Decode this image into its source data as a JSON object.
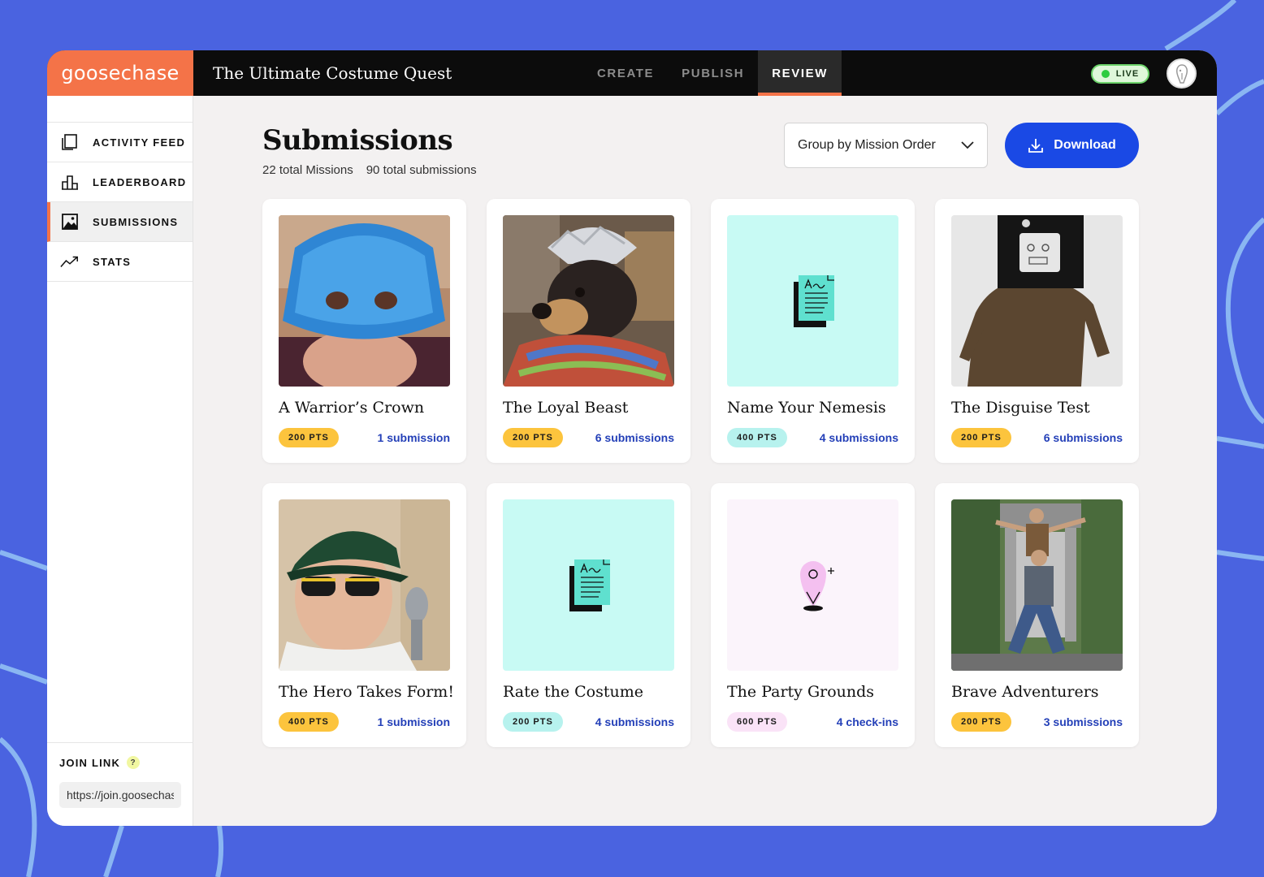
{
  "app": {
    "logo": "goosechase",
    "game_title": "The Ultimate Costume Quest",
    "tabs": [
      {
        "label": "CREATE",
        "active": false
      },
      {
        "label": "PUBLISH",
        "active": false
      },
      {
        "label": "REVIEW",
        "active": true
      }
    ],
    "live_label": "LIVE",
    "accent_color": "#f47348",
    "primary_color": "#1a49e5"
  },
  "sidebar": {
    "items": [
      {
        "label": "ACTIVITY FEED",
        "icon": "activity-feed-icon",
        "active": false
      },
      {
        "label": "LEADERBOARD",
        "icon": "leaderboard-icon",
        "active": false
      },
      {
        "label": "SUBMISSIONS",
        "icon": "image-icon",
        "active": true
      },
      {
        "label": "STATS",
        "icon": "trend-icon",
        "active": false
      }
    ],
    "join_label": "JOIN LINK",
    "join_help": "?",
    "join_url": "https://join.goosechase.ai"
  },
  "main": {
    "title": "Submissions",
    "total_missions": "22 total Missions",
    "total_submissions": "90 total submissions",
    "group_select": "Group by Mission Order",
    "download_label": "Download"
  },
  "missions": [
    {
      "title": "A Warrior’s Crown",
      "points": "200 PTS",
      "count": "1 submission",
      "type": "photo",
      "pts_color": "#fcc43d"
    },
    {
      "title": "The Loyal Beast",
      "points": "200 PTS",
      "count": "6 submissions",
      "type": "photo",
      "pts_color": "#fcc43d"
    },
    {
      "title": "Name Your Nemesis",
      "points": "400 PTS",
      "count": "4 submissions",
      "type": "text",
      "pts_color": "#b7f2ee"
    },
    {
      "title": "The Disguise Test",
      "points": "200 PTS",
      "count": "6 submissions",
      "type": "photo",
      "pts_color": "#fcc43d"
    },
    {
      "title": "The Hero Takes Form!",
      "points": "400 PTS",
      "count": "1 submission",
      "type": "photo",
      "pts_color": "#fcc43d"
    },
    {
      "title": "Rate the Costume",
      "points": "200 PTS",
      "count": "4 submissions",
      "type": "text",
      "pts_color": "#b7f2ee"
    },
    {
      "title": "The Party Grounds",
      "points": "600 PTS",
      "count": "4 check-ins",
      "type": "gps",
      "pts_color": "#fae3f7"
    },
    {
      "title": "Brave Adventurers",
      "points": "200 PTS",
      "count": "3 submissions",
      "type": "photo",
      "pts_color": "#fcc43d"
    }
  ]
}
